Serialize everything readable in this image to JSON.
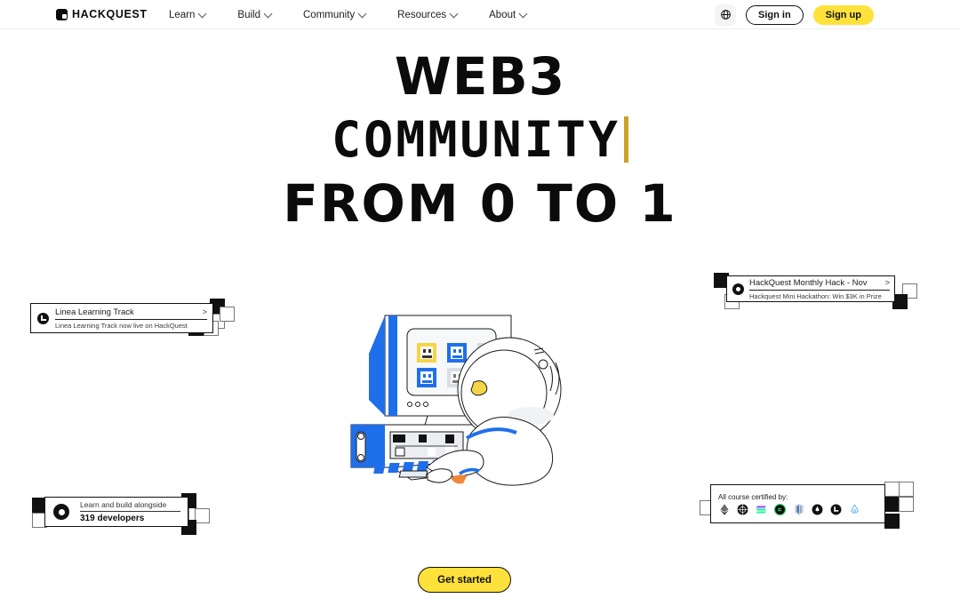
{
  "header": {
    "logo_text": "HACKQUEST",
    "nav": [
      {
        "label": "Learn"
      },
      {
        "label": "Build"
      },
      {
        "label": "Community"
      },
      {
        "label": "Resources"
      },
      {
        "label": "About"
      }
    ],
    "language_icon": "globe-icon",
    "sign_in": "Sign in",
    "sign_up": "Sign up"
  },
  "hero": {
    "line1": "WEB3",
    "line2": "COMMUNITY",
    "line3": "FROM 0 TO 1",
    "caret_color": "#C9A227",
    "cta": "Get started"
  },
  "cards": {
    "linea": {
      "icon": "linea-icon",
      "title": "Linea Learning Track",
      "arrow": ">",
      "subtitle": "Linea Learning Track now live on HackQuest"
    },
    "monthly_hack": {
      "icon": "hackquest-icon",
      "title": "HackQuest Monthly Hack - Nov",
      "arrow": ">",
      "subtitle": "Hackquest Mini Hackathon: Win $3K in Prize"
    },
    "developers": {
      "icon": "hackquest-icon",
      "title": "Learn and build alongside",
      "subtitle": "319 developers"
    },
    "certified": {
      "label": "All course certified by:",
      "chains": [
        {
          "name": "ethereum-icon",
          "color": "#3c3c3d"
        },
        {
          "name": "dark-globe-icon",
          "color": "#111111"
        },
        {
          "name": "solana-icon",
          "color": "#14F195"
        },
        {
          "name": "green-circle-icon",
          "color": "#25D366"
        },
        {
          "name": "mantle-icon",
          "color": "#4a6fa5"
        },
        {
          "name": "black-drop-icon",
          "color": "#111111"
        },
        {
          "name": "linea-icon",
          "color": "#111111"
        },
        {
          "name": "blue-drop-icon",
          "color": "#4DA6F0"
        }
      ]
    }
  },
  "illustration": {
    "name": "astronaut-at-computer-illustration",
    "accent_color": "#1F6FEB",
    "highlight_color": "#F5D547"
  },
  "colors": {
    "brand_yellow": "#FFE13B",
    "ink": "#0b0b0b",
    "blue": "#1F6FEB"
  }
}
